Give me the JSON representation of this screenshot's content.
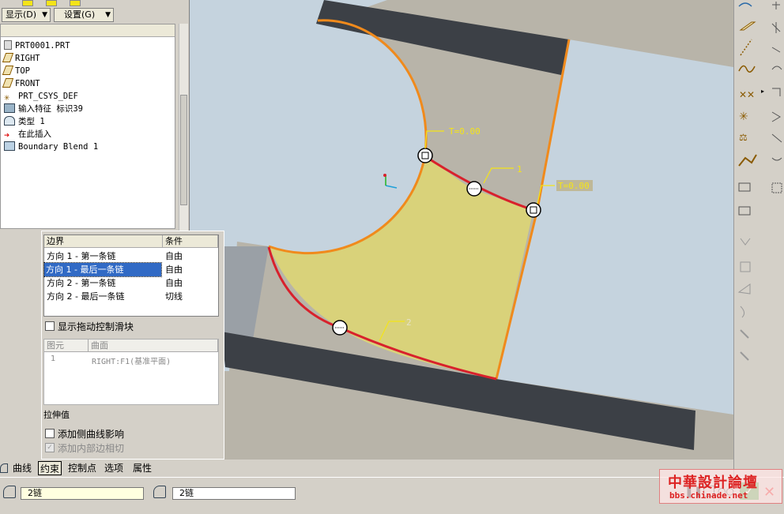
{
  "menus": {
    "display_label": "显示(D)",
    "settings_label": "设置(G)"
  },
  "model_tree": {
    "items": [
      {
        "label": "PRT0001.PRT",
        "icon": "part-icon"
      },
      {
        "label": "RIGHT",
        "icon": "datum-plane-icon"
      },
      {
        "label": "TOP",
        "icon": "datum-plane-icon"
      },
      {
        "label": "FRONT",
        "icon": "datum-plane-icon"
      },
      {
        "label": "PRT_CSYS_DEF",
        "icon": "csys-icon"
      },
      {
        "label": "输入特征 标识39",
        "icon": "import-feature-icon"
      },
      {
        "label": "类型 1",
        "icon": "surface-icon"
      },
      {
        "label": "在此插入",
        "icon": "insert-here-arrow-icon"
      },
      {
        "label": "Boundary Blend 1",
        "icon": "boundary-blend-icon"
      }
    ]
  },
  "constraints": {
    "col_boundary": "边界",
    "col_condition": "条件",
    "rows": [
      {
        "boundary": "方向 1 - 第一条链",
        "condition": "自由"
      },
      {
        "boundary": "方向 1 - 最后一条链",
        "condition": "自由",
        "selected": true
      },
      {
        "boundary": "方向 2 - 第一条链",
        "condition": "自由"
      },
      {
        "boundary": "方向 2 - 最后一条链",
        "condition": "切线"
      }
    ],
    "show_drag_handles_label": "显示拖动控制滑块",
    "element_col": "图元",
    "surface_col": "曲面",
    "element_row_num": "1",
    "element_row_surface": "RIGHT:F1(基准平面)",
    "stretch_label": "拉伸值",
    "add_side_curve_label": "添加侧曲线影响",
    "add_inner_edge_label": "添加内部边相切"
  },
  "tabs": [
    "曲线",
    "约束",
    "控制点",
    "选项",
    "属性"
  ],
  "active_tab": "约束",
  "status": {
    "chain1": "2链",
    "chain2": "2链"
  },
  "viewport": {
    "label_t1": "T=0.00",
    "label_t2": "T=0.00",
    "label_one": "1",
    "label_two": "2"
  },
  "watermark": {
    "line1": "中華設計論壇",
    "line2": "bbs.chinade.net"
  },
  "colors": {
    "surface_blue": "#c5d3de",
    "dark_band": "#3c4046",
    "tan_area": "#b6b0a2",
    "yellow_patch": "#d9d27a",
    "red_edge": "#d8212c",
    "orange_edge": "#f08a1c",
    "selection_blue": "#316ac5",
    "label_yellow": "#f4e418"
  }
}
